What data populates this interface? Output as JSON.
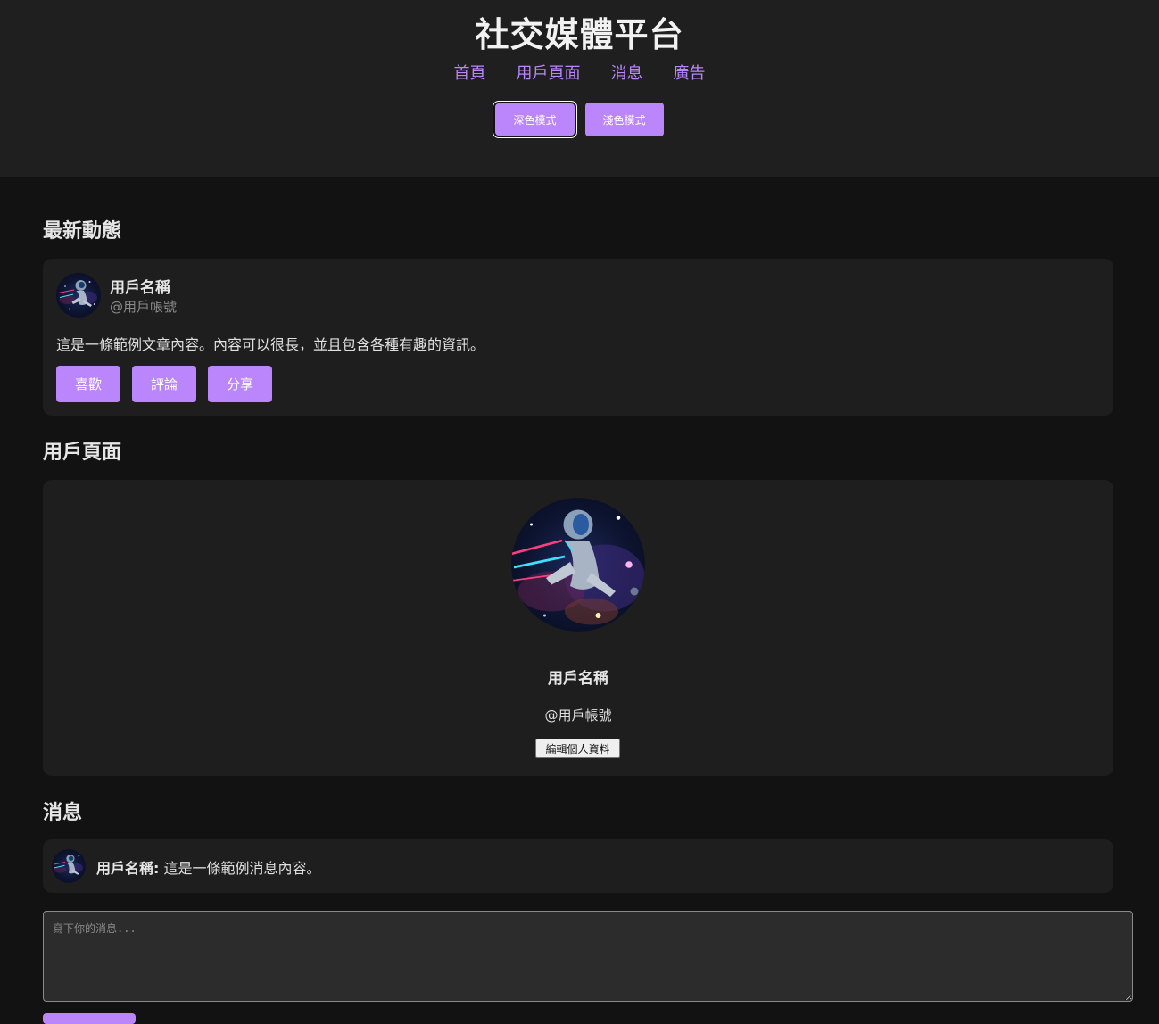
{
  "header": {
    "title": "社交媒體平台",
    "nav": [
      "首頁",
      "用戶頁面",
      "消息",
      "廣告"
    ],
    "dark_mode_label": "深色模式",
    "light_mode_label": "淺色模式"
  },
  "feed": {
    "section_title": "最新動態",
    "post": {
      "avatar": "astronaut-avatar-icon",
      "user_name": "用戶名稱",
      "handle": "@用戶帳號",
      "content": "這是一條範例文章內容。內容可以很長，並且包含各種有趣的資訊。",
      "actions": [
        "喜歡",
        "評論",
        "分享"
      ]
    }
  },
  "profile": {
    "section_title": "用戶頁面",
    "avatar": "astronaut-avatar-icon",
    "user_name": "用戶名稱",
    "handle": "@用戶帳號",
    "edit_label": "編輯個人資料"
  },
  "messages": {
    "section_title": "消息",
    "item": {
      "avatar": "astronaut-avatar-icon",
      "sender": "用戶名稱:",
      "text": " 這是一條範例消息內容。"
    },
    "input_placeholder": "寫下你的消息..."
  },
  "colors": {
    "accent": "#bb86fc",
    "background": "#121212",
    "header_bg": "#1f1f1f",
    "card_bg": "#1e1e1e"
  }
}
